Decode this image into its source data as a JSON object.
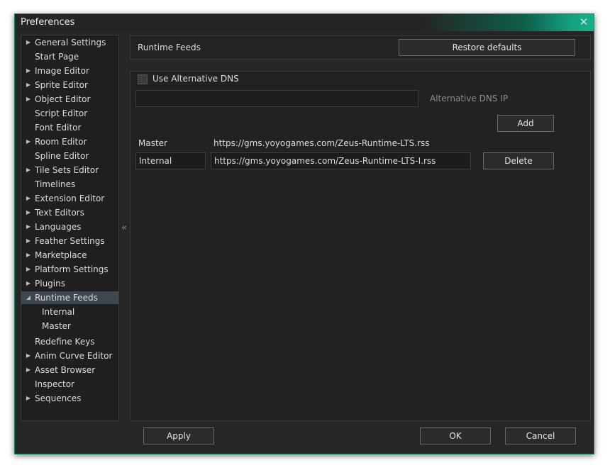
{
  "window": {
    "title": "Preferences",
    "accent_color": "#14a07e"
  },
  "sidebar": {
    "items": [
      {
        "label": "General Settings",
        "expandable": true
      },
      {
        "label": "Start Page",
        "expandable": false
      },
      {
        "label": "Image Editor",
        "expandable": true
      },
      {
        "label": "Sprite Editor",
        "expandable": true
      },
      {
        "label": "Object Editor",
        "expandable": true
      },
      {
        "label": "Script Editor",
        "expandable": false
      },
      {
        "label": "Font Editor",
        "expandable": false
      },
      {
        "label": "Room Editor",
        "expandable": true
      },
      {
        "label": "Spline Editor",
        "expandable": false
      },
      {
        "label": "Tile Sets Editor",
        "expandable": true
      },
      {
        "label": "Timelines",
        "expandable": false
      },
      {
        "label": "Extension Editor",
        "expandable": true
      },
      {
        "label": "Text Editors",
        "expandable": true
      },
      {
        "label": "Languages",
        "expandable": true
      },
      {
        "label": "Feather Settings",
        "expandable": true
      },
      {
        "label": "Marketplace",
        "expandable": true
      },
      {
        "label": "Platform Settings",
        "expandable": true
      },
      {
        "label": "Plugins",
        "expandable": true
      },
      {
        "label": "Runtime Feeds",
        "expandable": true,
        "expanded": true,
        "selected": true,
        "children": [
          {
            "label": "Internal"
          },
          {
            "label": "Master"
          }
        ]
      },
      {
        "label": "Redefine Keys",
        "expandable": false
      },
      {
        "label": "Anim Curve Editor",
        "expandable": true
      },
      {
        "label": "Asset Browser",
        "expandable": true
      },
      {
        "label": "Inspector",
        "expandable": false
      },
      {
        "label": "Sequences",
        "expandable": true
      }
    ]
  },
  "header": {
    "section_title": "Runtime Feeds",
    "restore_label": "Restore defaults"
  },
  "dns": {
    "use_alt_label": "Use Alternative DNS",
    "use_alt_checked": false,
    "ip_value": "",
    "ip_label": "Alternative DNS IP",
    "add_label": "Add"
  },
  "feeds": [
    {
      "name": "Master",
      "url": "https://gms.yoyogames.com/Zeus-Runtime-LTS.rss",
      "selected": false
    },
    {
      "name": "Internal",
      "url": "https://gms.yoyogames.com/Zeus-Runtime-LTS-I.rss",
      "selected": true
    }
  ],
  "delete_label": "Delete",
  "footer": {
    "apply_label": "Apply",
    "ok_label": "OK",
    "cancel_label": "Cancel"
  }
}
